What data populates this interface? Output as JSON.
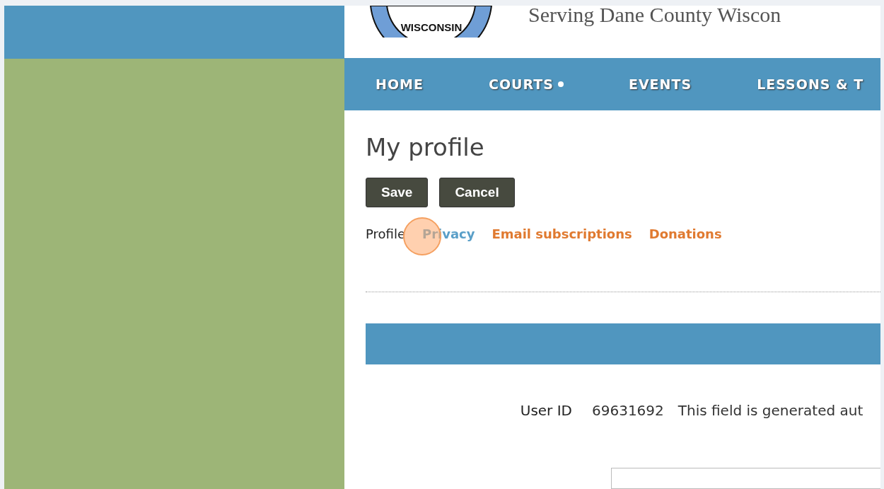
{
  "header": {
    "logo_text": "WISCONSIN",
    "tagline": "Serving Dane County Wiscon"
  },
  "nav": [
    {
      "label": "HOME",
      "dot": false
    },
    {
      "label": "COURTS",
      "dot": true
    },
    {
      "label": "EVENTS",
      "dot": false
    },
    {
      "label": "LESSONS & T",
      "dot": false
    }
  ],
  "page_title": "My profile",
  "buttons": [
    "Save",
    "Cancel"
  ],
  "tabs": [
    {
      "label": "Profile",
      "selected": true,
      "hovered": false
    },
    {
      "label": "Privacy",
      "selected": false,
      "hovered": true
    },
    {
      "label": "Email subscriptions",
      "selected": false,
      "hovered": false
    },
    {
      "label": "Donations",
      "selected": false,
      "hovered": false
    }
  ],
  "fields": [
    {
      "label": "User ID",
      "value": "69631692",
      "hint": "This field is generated aut"
    }
  ],
  "click_indicator": true
}
